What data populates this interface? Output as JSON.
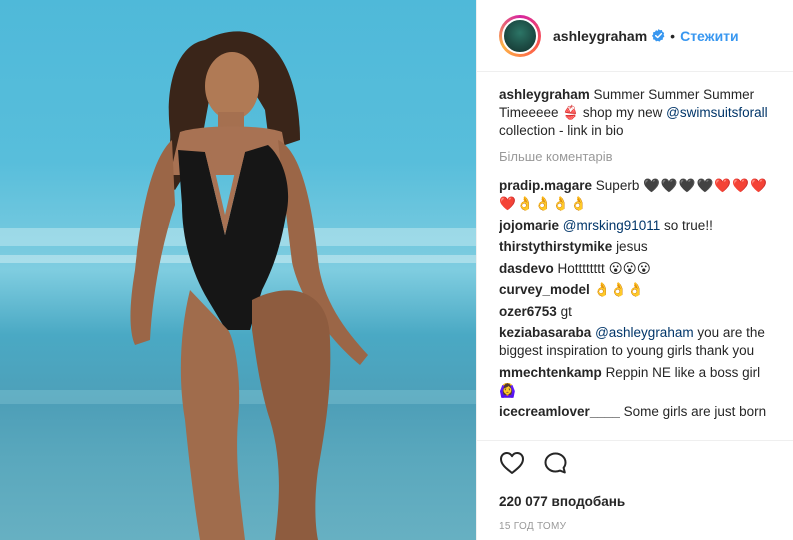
{
  "post": {
    "image_alt": "Woman in black one-piece swimsuit walking on a beach",
    "author": "ashleygraham",
    "follow_label": "Стежити",
    "dot": "•",
    "caption": {
      "username": "ashleygraham",
      "text_before": " Summer Summer Summer Timeeeee ",
      "bikini_emoji": "👙",
      "text_middle": " shop my new ",
      "mention": "@swimsuitsforall",
      "text_after": " collection - link in bio"
    },
    "more_comments": "Більше коментарів",
    "comments": [
      {
        "username": "pradip.magare",
        "text": "Superb",
        "emoji": "🖤🖤🖤🖤❤️❤️❤️❤️👌👌👌👌"
      },
      {
        "username": "jojomarie",
        "mention": "@mrsking91011",
        "text": " so true!!"
      },
      {
        "username": "thirstythirstymike",
        "text": "jesus"
      },
      {
        "username": "dasdevo",
        "text": "Hotttttttt",
        "emoji": "😮😮😮"
      },
      {
        "username": "curvey_model",
        "text": "",
        "emoji": "👌👌👌"
      },
      {
        "username": "ozer6753",
        "text": "gt"
      },
      {
        "username": "keziabasaraba",
        "mention": "@ashleygraham",
        "text": " you are the biggest inspiration to young girls thank you"
      },
      {
        "username": "mmechtenkamp",
        "text": "Reppin NE like a boss girl",
        "emoji": "🙆‍♀️"
      },
      {
        "username": "icecreamlover____",
        "text": "Some girls are just born"
      }
    ],
    "likes": "220 077 вподобань",
    "timestamp": "15 год тому"
  },
  "icons": {
    "like": "heart-icon",
    "comment": "comment-icon",
    "verified": "verified-badge-icon"
  },
  "colors": {
    "link": "#3897f0",
    "mention": "#003569",
    "muted": "#999999",
    "text": "#262626"
  }
}
